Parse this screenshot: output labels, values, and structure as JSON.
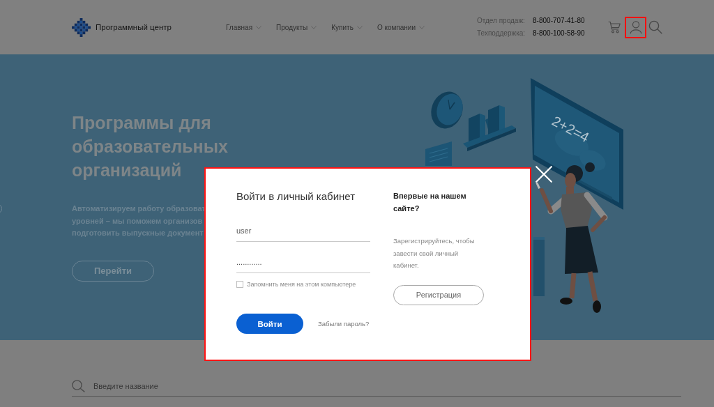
{
  "header": {
    "logo_text": "Программный центр",
    "nav": [
      {
        "label": "Главная"
      },
      {
        "label": "Продукты"
      },
      {
        "label": "Купить"
      },
      {
        "label": "О компании"
      }
    ],
    "contacts": [
      {
        "label": "Отдел продаж:",
        "phone": "8-800-707-41-80"
      },
      {
        "label": "Техподдержка:",
        "phone": "8-800-100-58-90"
      }
    ],
    "account_button": {
      "highlighted": true
    }
  },
  "hero": {
    "title": "Программы для образовательных организаций",
    "description_lines": [
      "Автоматизируем работу образоват",
      "уровней – мы поможем организов",
      "подготовить выпускные документ"
    ],
    "button": "Перейти",
    "board_text": "2+2=4"
  },
  "login_modal": {
    "highlighted": true,
    "title": "Войти в личный кабинет",
    "username": {
      "value": "user"
    },
    "password": {
      "value": "............"
    },
    "remember": {
      "label": "Запомнить меня на этом компьютере",
      "checked": false
    },
    "submit": "Войти",
    "forgot_link": "Забыли пароль?",
    "register_heading": "Впервые на нашем сайте?",
    "register_text": "Зарегистрируйтесь, чтобы завести свой личный кабинет.",
    "register_button": "Регистрация"
  },
  "search": {
    "placeholder": "Введите название"
  }
}
